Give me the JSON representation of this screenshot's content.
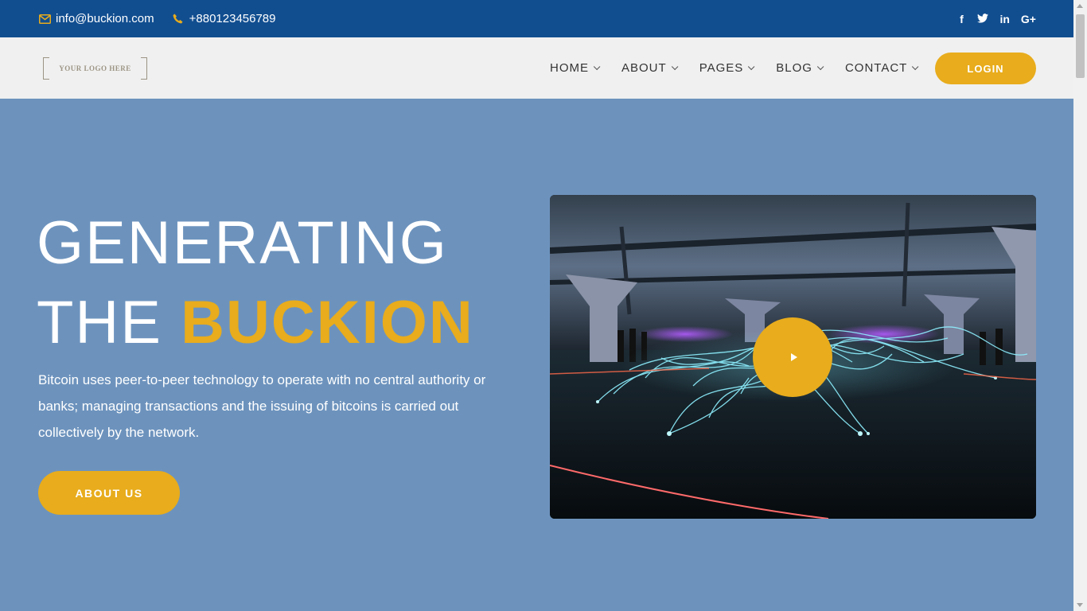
{
  "topbar": {
    "email": "info@buckion.com",
    "phone": "+880123456789",
    "email_icon": "envelope-icon",
    "phone_icon": "phone-icon",
    "social": [
      {
        "icon": "facebook-icon",
        "glyph": "f"
      },
      {
        "icon": "twitter-icon",
        "glyph": "🐦"
      },
      {
        "icon": "linkedin-icon",
        "glyph": "in"
      },
      {
        "icon": "google-plus-icon",
        "glyph": "G+"
      }
    ]
  },
  "header": {
    "logo_text": "YOUR LOGO HERE",
    "nav": [
      {
        "label": "HOME"
      },
      {
        "label": "ABOUT"
      },
      {
        "label": "PAGES"
      },
      {
        "label": "BLOG"
      },
      {
        "label": "CONTACT"
      }
    ],
    "login_label": "LOGIN"
  },
  "hero": {
    "title_line1": "GENERATING",
    "title_line2_prefix": "THE ",
    "title_line2_accent": "BUCKION",
    "description": "Bitcoin uses peer-to-peer technology to operate with no central authority or banks; managing transactions and the issuing of bitcoins is carried out collectively by the network.",
    "button_label": "ABOUT US",
    "video_icon": "play-icon"
  },
  "colors": {
    "topbar_bg": "#114e90",
    "header_bg": "#f0f0f0",
    "hero_bg": "#6d93bd",
    "accent": "#e8ac1c"
  }
}
